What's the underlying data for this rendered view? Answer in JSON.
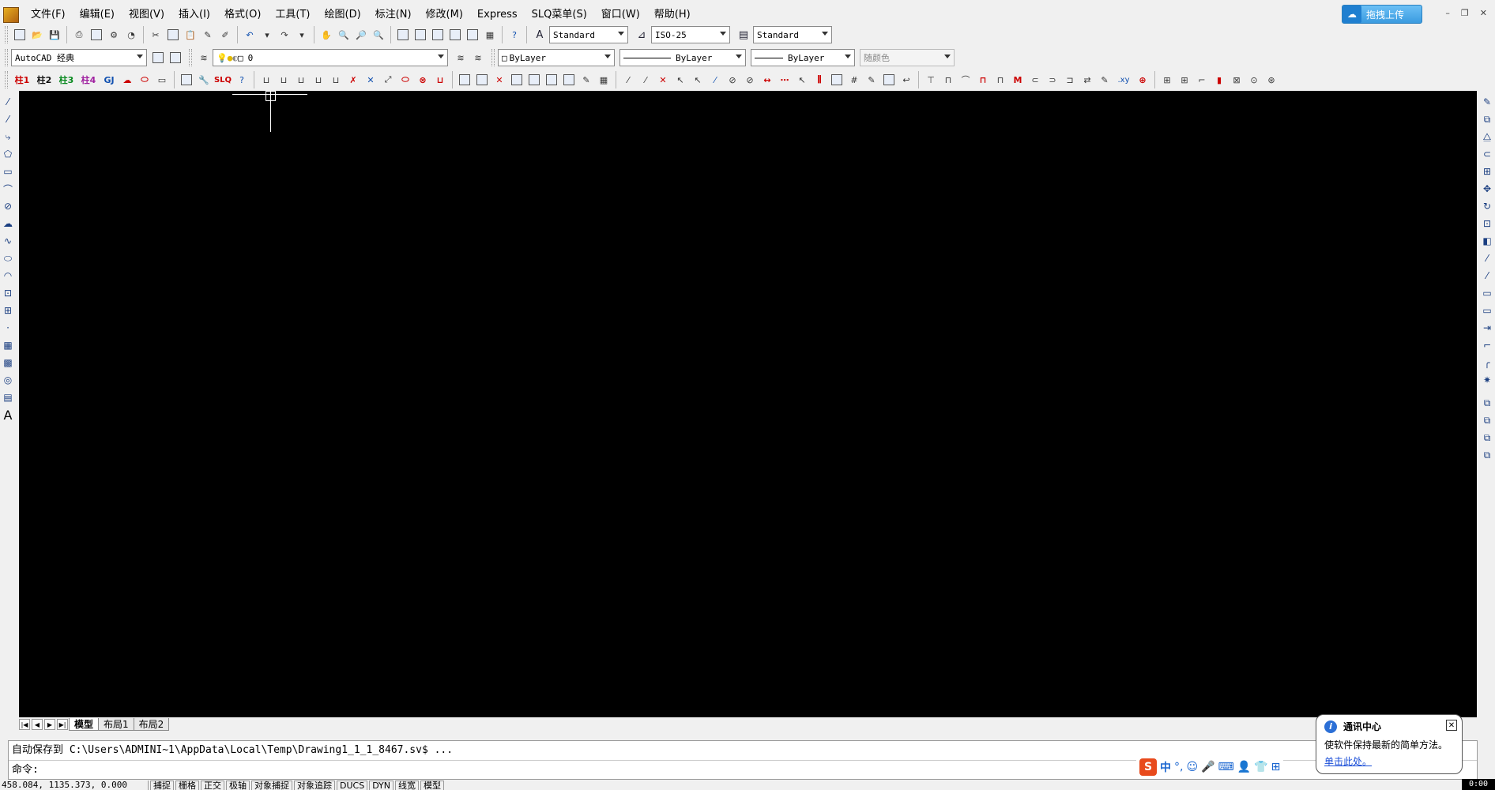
{
  "menubar": {
    "items": [
      "文件(F)",
      "编辑(E)",
      "视图(V)",
      "插入(I)",
      "格式(O)",
      "工具(T)",
      "绘图(D)",
      "标注(N)",
      "修改(M)",
      "Express",
      "SLQ菜单(S)",
      "窗口(W)",
      "帮助(H)"
    ],
    "upload_label": "拖拽上传"
  },
  "styles": {
    "text_style": "Standard",
    "dim_style": "ISO-25",
    "table_style": "Standard"
  },
  "workspace": "AutoCAD 经典",
  "layer": "0",
  "properties": {
    "color": "ByLayer",
    "linetype": "ByLayer",
    "lineweight": "ByLayer",
    "plot_style": "随颜色"
  },
  "toolbar3": {
    "labels": [
      "柱1",
      "柱2",
      "柱3",
      "柱4",
      "GJ",
      "SLQ"
    ]
  },
  "layout_tabs": [
    "模型",
    "布局1",
    "布局2"
  ],
  "command": {
    "history": "自动保存到 C:\\Users\\ADMINI~1\\AppData\\Local\\Temp\\Drawing1_1_1_8467.sv$ ...",
    "prompt": "命令:"
  },
  "statusbar": {
    "coords": "458.084, 1135.373, 0.000",
    "buttons": [
      "捕捉",
      "栅格",
      "正交",
      "极轴",
      "对象捕捉",
      "对象追踪",
      "DUCS",
      "DYN",
      "线宽",
      "模型"
    ]
  },
  "ime": {
    "mode": "中"
  },
  "notification": {
    "title": "通讯中心",
    "message": "使软件保持最新的简单方法。",
    "link": "单击此处。"
  },
  "clock": "0:00",
  "colors": {
    "canvas": "#000000",
    "ui": "#f0f0f0",
    "upload": "#3a9be0"
  }
}
